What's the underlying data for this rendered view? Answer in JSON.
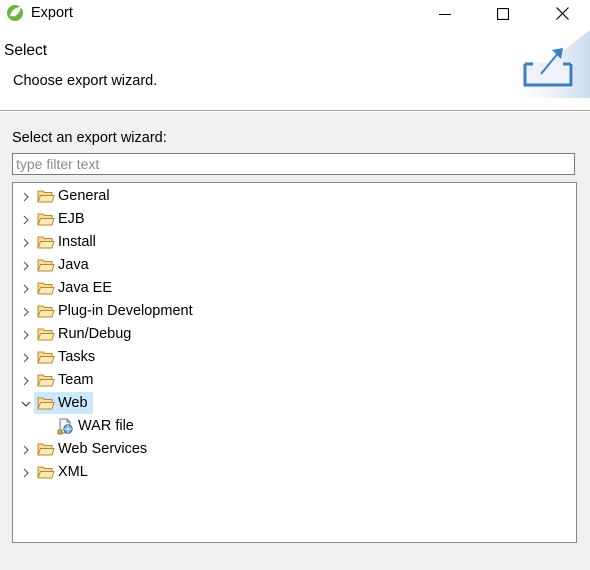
{
  "window": {
    "title": "Export",
    "controls": {
      "minimize": "minimize",
      "maximize": "maximize",
      "close": "close"
    }
  },
  "header": {
    "title": "Select",
    "description": "Choose export wizard.",
    "graphic": "export-banner-icon"
  },
  "wizard": {
    "prompt": "Select an export wizard:",
    "filter_placeholder": "type filter text",
    "filter_value": ""
  },
  "tree": {
    "items": [
      {
        "label": "General",
        "expanded": false
      },
      {
        "label": "EJB",
        "expanded": false
      },
      {
        "label": "Install",
        "expanded": false
      },
      {
        "label": "Java",
        "expanded": false
      },
      {
        "label": "Java EE",
        "expanded": false
      },
      {
        "label": "Plug-in Development",
        "expanded": false
      },
      {
        "label": "Run/Debug",
        "expanded": false
      },
      {
        "label": "Tasks",
        "expanded": false
      },
      {
        "label": "Team",
        "expanded": false
      },
      {
        "label": "Web",
        "expanded": true,
        "selected": true,
        "children": [
          {
            "label": "WAR file",
            "icon": "war-file-icon"
          }
        ]
      },
      {
        "label": "Web Services",
        "expanded": false
      },
      {
        "label": "XML",
        "expanded": false
      }
    ]
  },
  "colors": {
    "selection": "#cce8ff",
    "folder": "#dcb35c",
    "banner": "#3c7fc0"
  }
}
